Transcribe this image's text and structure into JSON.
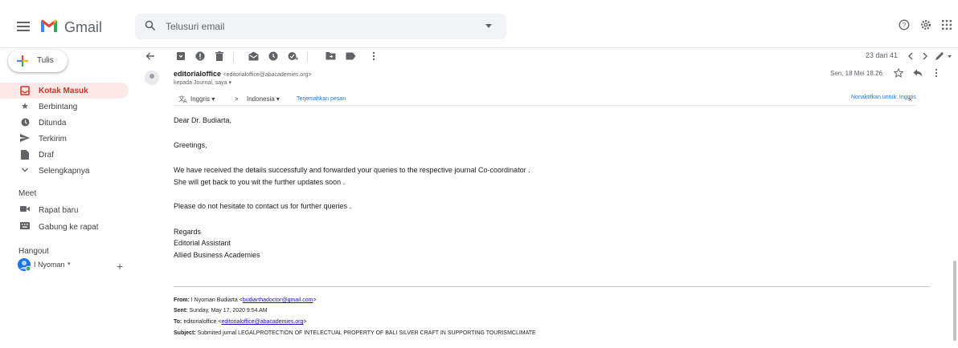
{
  "app": {
    "name": "Gmail",
    "search_placeholder": "Telusuri email"
  },
  "sidebar": {
    "compose_label": "Tulis",
    "items": [
      {
        "label": "Kotak Masuk",
        "icon": "inbox-icon",
        "active": true
      },
      {
        "label": "Berbintang",
        "icon": "star-icon"
      },
      {
        "label": "Ditunda",
        "icon": "clock-icon"
      },
      {
        "label": "Terkirim",
        "icon": "send-icon"
      },
      {
        "label": "Draf",
        "icon": "draft-icon"
      },
      {
        "label": "Selengkapnya",
        "icon": "chevron-down-icon"
      }
    ],
    "meet_title": "Meet",
    "meet_items": [
      {
        "label": "Rapat baru",
        "icon": "video-icon"
      },
      {
        "label": "Gabung ke rapat",
        "icon": "keyboard-icon"
      }
    ],
    "hangout_title": "Hangout",
    "hangout_user": "I Nyoman",
    "hangout_user_caret": "▾",
    "hangout_add": "+"
  },
  "toolbar": {
    "count": "23 dari 41"
  },
  "message": {
    "sender_name": "editorialoffice",
    "sender_email": "<editorialoffice@abacademies.org>",
    "to_line": "kepada Journal, saya ▾",
    "date": "Sen, 18 Mei 18.26",
    "translate": {
      "from_lang": "Inggris ▾",
      "arrow": ">",
      "to_lang": "Indonesia ▾",
      "translate_link": "Terjemahkan pesan",
      "disable": "Nonaktifkan untuk: Inggris",
      "close": "×"
    },
    "body": [
      "Dear Dr. Budiarta,",
      "Greetings,",
      "We have received the details successfully and forwarded your queries to the respective journal Co-coordinator .",
      "She will get back to you wit the further updates soon .",
      "Please do not hesitate to contact us for further queries .",
      "Regards",
      "Editorial Assistant",
      "Allied Business Academies"
    ],
    "quoted": {
      "from_label": "From:",
      "from_value": "I Nyoman Budiarta <",
      "from_email": "budiarthadoctor@gmail.com",
      "from_close": ">",
      "sent_label": "Sent:",
      "sent_value": "Sunday, May 17, 2020 9:54 AM",
      "to_label": "To:",
      "to_value": "editorialoffice <",
      "to_email": "editorialoffice@abacademies.org",
      "to_close": ">",
      "subject_label": "Subject:",
      "subject_value": "Submited jurnal LEGALPROTECTION OF INTELECTUAL PROPERTY OF BALI SILVER CRAFT IN SUPPORTING TOURISMCLIMATE"
    }
  },
  "colors": {
    "accent_red": "#d93025",
    "active_bg": "#fce8e6",
    "link_blue": "#1a73e8"
  }
}
